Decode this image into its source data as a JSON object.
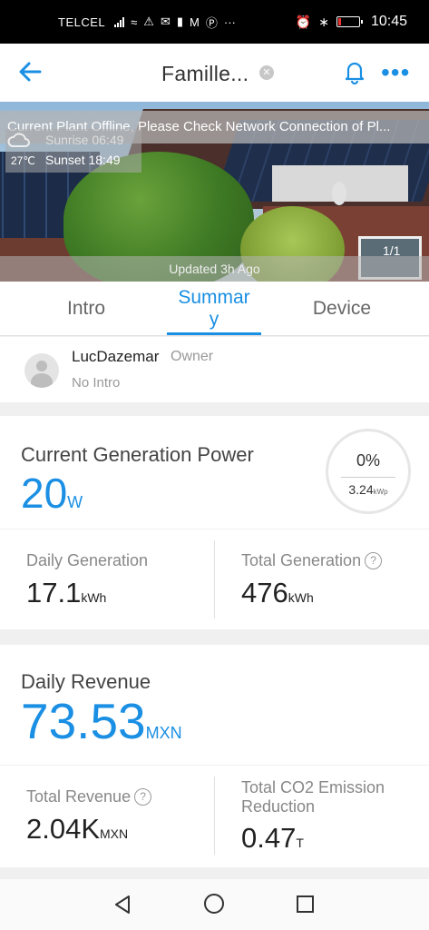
{
  "status_bar": {
    "carrier": "TELCEL",
    "time": "10:45",
    "icons": [
      "signal-icon",
      "wifi-icon",
      "warning-icon",
      "mail-icon",
      "sim-icon",
      "gmail-icon",
      "pinterest-icon",
      "more-icon",
      "alarm-icon",
      "bluetooth-icon",
      "battery-icon"
    ],
    "battery_level": 0.15
  },
  "header": {
    "title": "Famille...",
    "icons": [
      "back-arrow-icon",
      "close-icon",
      "bell-icon",
      "more-icon"
    ],
    "accent_color": "#1a8fe3"
  },
  "banner": {
    "offline_message": "Current Plant Offline, Please Check Network Connection of Pl...",
    "temperature": "27℃",
    "sunrise_label": "Sunrise",
    "sunrise_time": "06:49",
    "sunset_label": "Sunset",
    "sunset_time": "18:49",
    "pager": "1/1",
    "updated": "Updated 3h Ago"
  },
  "tabs": [
    {
      "label": "Intro",
      "active": false
    },
    {
      "label": "Summary",
      "active": true
    },
    {
      "label": "Device",
      "active": false
    }
  ],
  "owner": {
    "name": "LucDazemar",
    "role": "Owner",
    "intro": "No Intro"
  },
  "power": {
    "label": "Current Generation Power",
    "value": "20",
    "unit": "W",
    "percent": "0%",
    "capacity": "3.24",
    "capacity_unit": "kWp"
  },
  "generation": {
    "daily_label": "Daily Generation",
    "daily_value": "17.1",
    "daily_unit": "kWh",
    "total_label": "Total Generation",
    "total_value": "476",
    "total_unit": "kWh"
  },
  "revenue": {
    "daily_label": "Daily Revenue",
    "daily_value": "73.53",
    "daily_unit": "MXN",
    "total_label": "Total Revenue",
    "total_value": "2.04K",
    "total_unit": "MXN",
    "co2_label_line1": "Total CO2 Emission",
    "co2_label_line2": "Reduction",
    "co2_value": "0.47",
    "co2_unit": "T"
  },
  "navbar": {
    "icons": [
      "nav-back-icon",
      "nav-home-icon",
      "nav-recent-icon"
    ]
  }
}
